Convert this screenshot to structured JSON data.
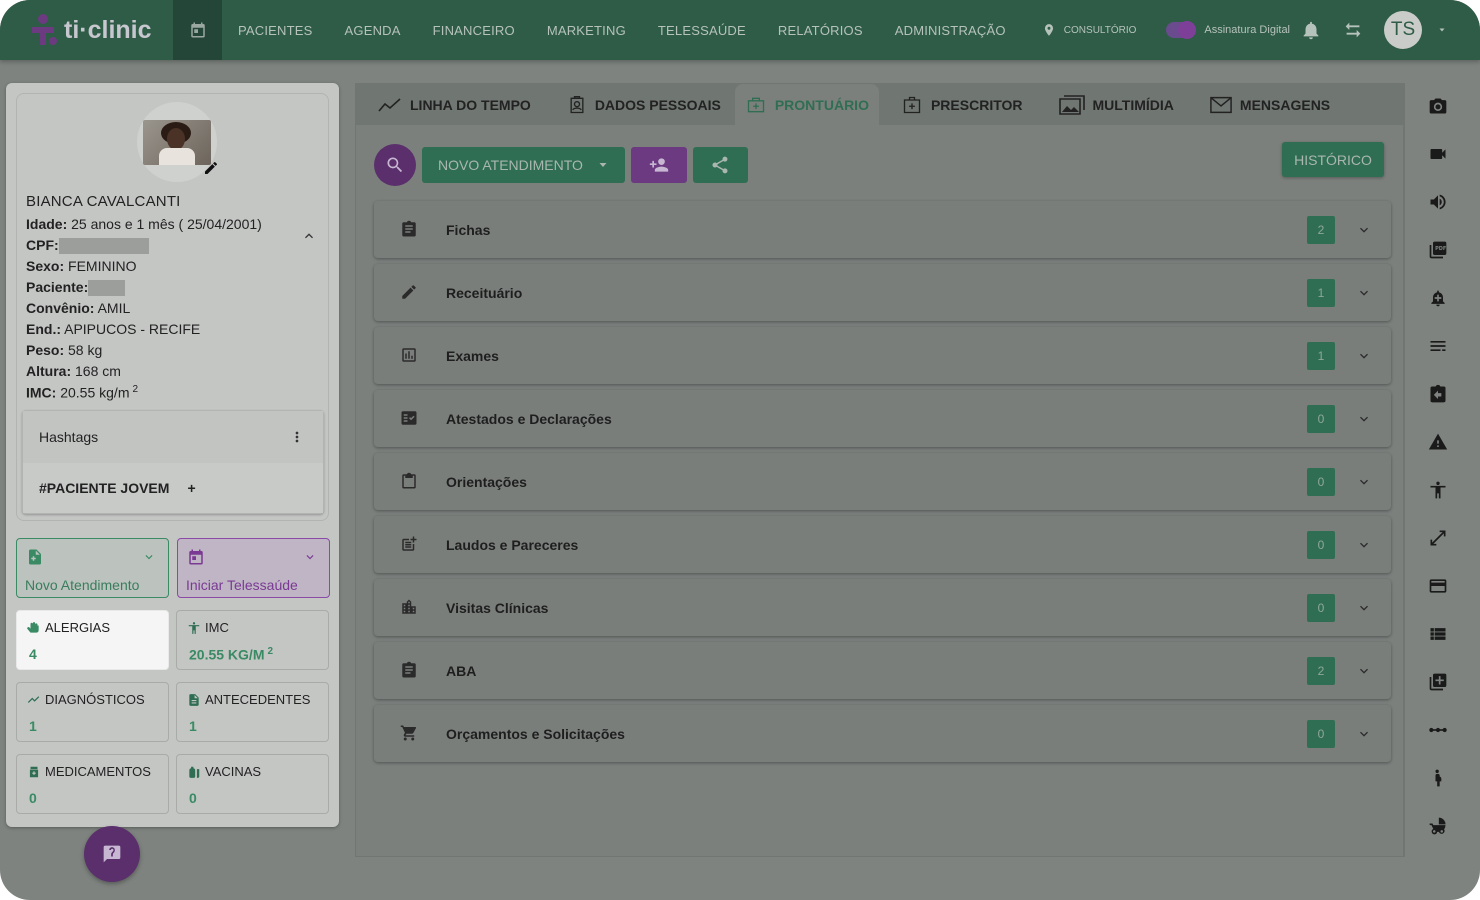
{
  "brand": {
    "name": "ti·clinic"
  },
  "nav": {
    "items": [
      "PACIENTES",
      "AGENDA",
      "FINANCEIRO",
      "MARKETING",
      "TELESSAÚDE",
      "RELATÓRIOS",
      "ADMINISTRAÇÃO"
    ],
    "location": "CONSULTÓRIO",
    "signature_label": "Assinatura Digital",
    "user_initials": "TS"
  },
  "patient": {
    "name": "BIANCA CAVALCANTI",
    "idade_label": "Idade:",
    "idade": " 25 anos e 1 mês ( 25/04/2001)",
    "cpf_label": "CPF:",
    "sexo_label": "Sexo:",
    "sexo": " FEMININO",
    "paciente_label": "Paciente:",
    "convenio_label": "Convênio:",
    "convenio": " AMIL",
    "end_label": "End.:",
    "end": " APIPUCOS -  RECIFE",
    "peso_label": "Peso:",
    "peso": " 58 kg",
    "altura_label": "Altura:",
    "altura": " 168 cm",
    "imc_label": "IMC:",
    "imc": " 20.55 kg/m",
    "imc_sup": "2"
  },
  "hashtags": {
    "title": "Hashtags",
    "tag": "#PACIENTE JOVEM",
    "add": "+"
  },
  "actions": {
    "novo": "Novo Atendimento",
    "tele": "Iniciar Telessaúde"
  },
  "stats": [
    {
      "label": "ALERGIAS",
      "value": "4"
    },
    {
      "label": "IMC",
      "value": "20.55 KG/M",
      "sup": "2"
    },
    {
      "label": "DIAGNÓSTICOS",
      "value": "1"
    },
    {
      "label": "ANTECEDENTES",
      "value": "1"
    },
    {
      "label": "MEDICAMENTOS",
      "value": "0"
    },
    {
      "label": "VACINAS",
      "value": "0"
    }
  ],
  "tabs": [
    "LINHA DO TEMPO",
    "DADOS PESSOAIS",
    "PRONTUÁRIO",
    "PRESCRITOR",
    "MULTIMÍDIA",
    "MENSAGENS"
  ],
  "toolbar": {
    "novo_atendimento": "NOVO ATENDIMENTO",
    "historico": "HISTÓRICO"
  },
  "sections": [
    {
      "title": "Fichas",
      "count": "2"
    },
    {
      "title": "Receituário",
      "count": "1"
    },
    {
      "title": "Exames",
      "count": "1"
    },
    {
      "title": "Atestados e Declarações",
      "count": "0"
    },
    {
      "title": "Orientações",
      "count": "0"
    },
    {
      "title": "Laudos e Pareceres",
      "count": "0"
    },
    {
      "title": "Visitas Clínicas",
      "count": "0"
    },
    {
      "title": "ABA",
      "count": "2"
    },
    {
      "title": "Orçamentos e Solicitações",
      "count": "0"
    }
  ],
  "rail_icons": [
    "camera-icon",
    "video-icon",
    "volume-icon",
    "pdf-icon",
    "alarm-add-icon",
    "list-icon",
    "assignment-return-icon",
    "warning-icon",
    "accessibility-icon",
    "expand-icon",
    "credit-card-icon",
    "view-list-icon",
    "library-add-icon",
    "linear-scale-icon",
    "pregnant-icon",
    "stroller-icon"
  ],
  "colors": {
    "nav_bg": "#2f5c47",
    "accent_green": "#2f6e53",
    "accent_purple": "#6b3a80"
  }
}
